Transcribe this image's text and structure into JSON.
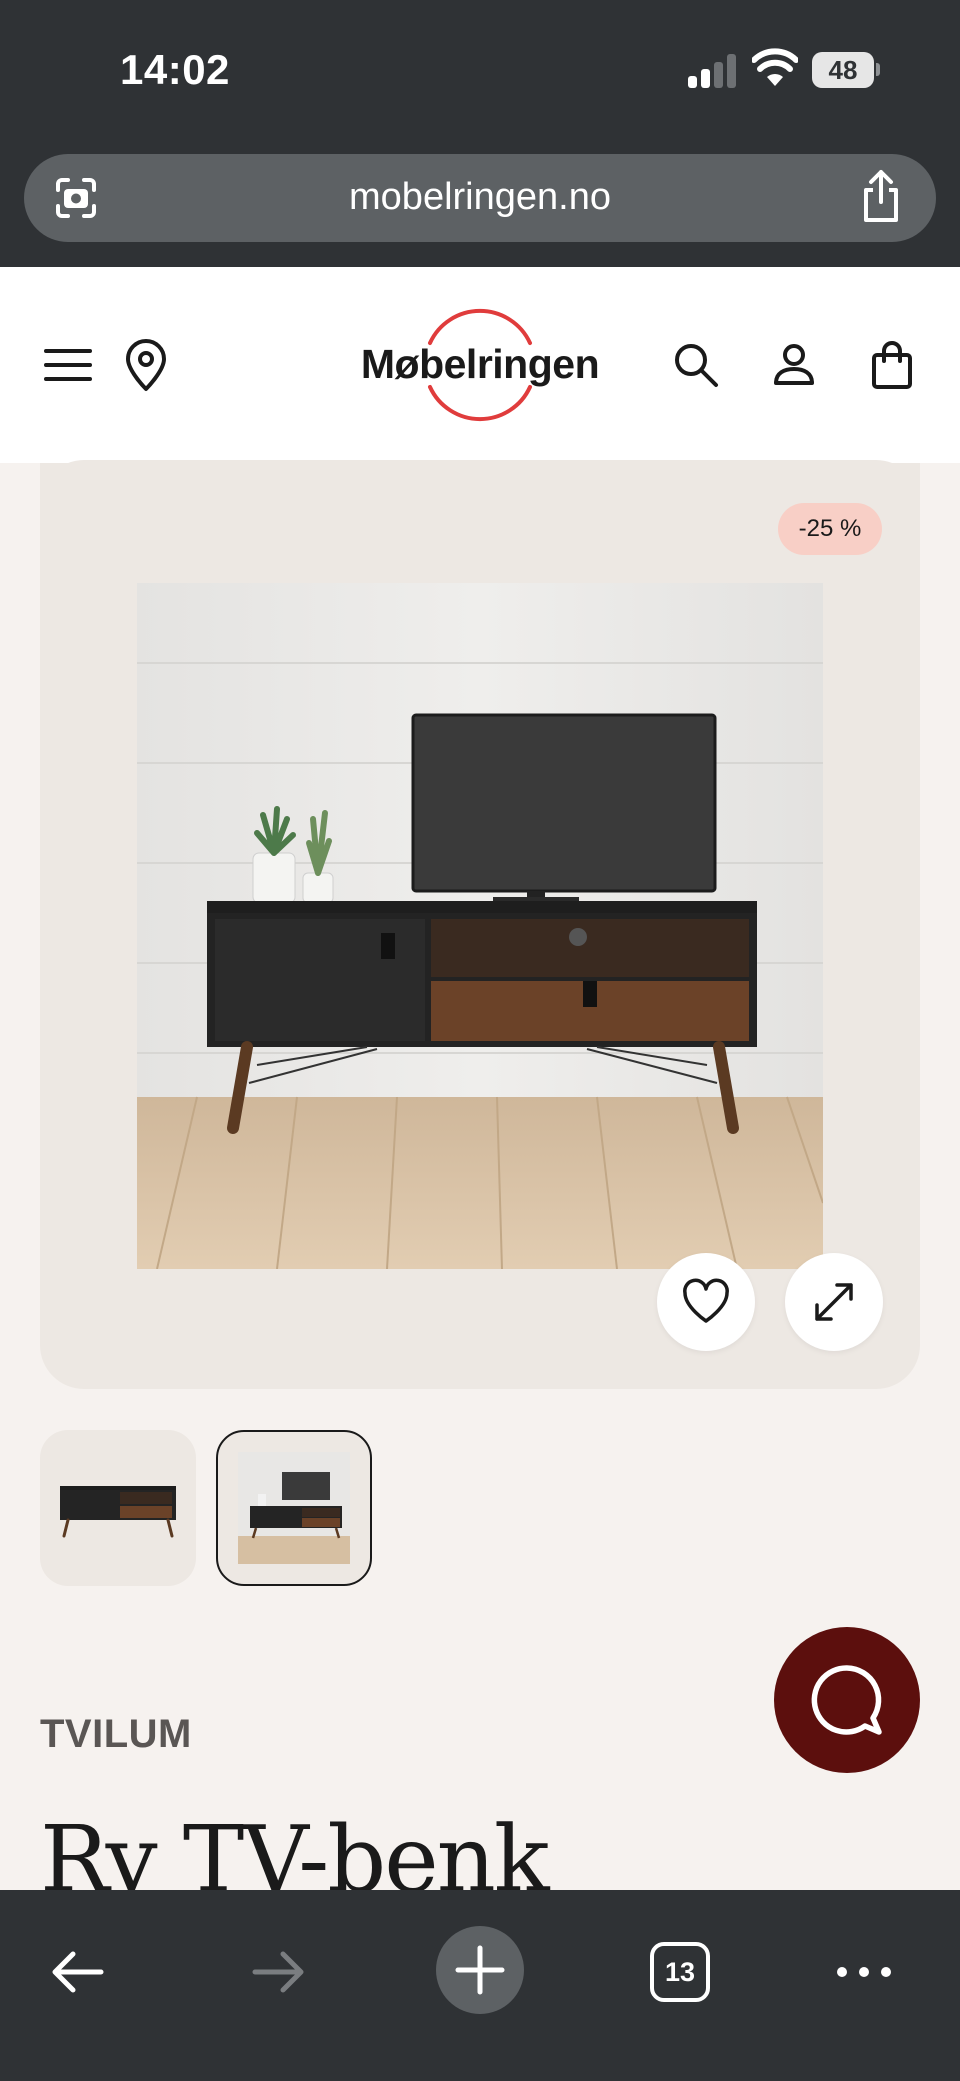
{
  "status_bar": {
    "time": "14:02",
    "battery": "48"
  },
  "browser": {
    "url": "mobelringen.no",
    "open_tabs": "13"
  },
  "site": {
    "logo_text": "Møbelringen",
    "brand_color": "#e03c3c",
    "icons": [
      "menu-icon",
      "location-pin-icon",
      "search-icon",
      "account-icon",
      "shopping-bag-icon"
    ]
  },
  "product": {
    "discount": "-25 %",
    "brand": "TVILUM",
    "title": "Ry TV-benk",
    "thumbnail_count": 2,
    "selected_thumbnail": 2
  },
  "colors": {
    "page_bg": "#f6f2ef",
    "gallery_bg": "#ede8e3",
    "discount_badge": "#f8cfc6",
    "chat_button": "#5c0f0d",
    "browser_chrome": "#2f3235"
  }
}
